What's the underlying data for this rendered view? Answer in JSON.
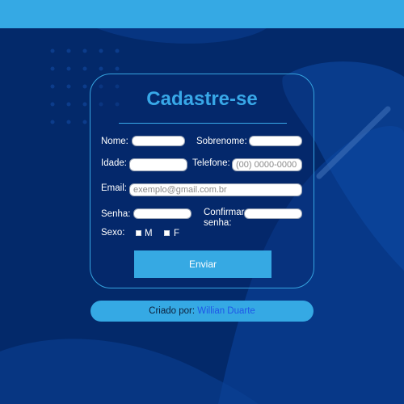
{
  "form": {
    "title": "Cadastre-se",
    "labels": {
      "nome": "Nome:",
      "sobrenome": "Sobrenome:",
      "idade": "Idade:",
      "telefone": "Telefone:",
      "email": "Email:",
      "senha": "Senha:",
      "confirmar_senha": "Confirmar senha:",
      "sexo": "Sexo:",
      "sexo_m": "M",
      "sexo_f": "F"
    },
    "placeholders": {
      "telefone": "(00) 0000-0000",
      "email": "exemplo@gmail.com.br"
    },
    "submit_label": "Enviar"
  },
  "footer": {
    "prefix": "Criado por:",
    "author": "Willian Duarte"
  },
  "colors": {
    "accent": "#35a9e4",
    "background": "#03296a",
    "author_link": "#1e56e8"
  }
}
